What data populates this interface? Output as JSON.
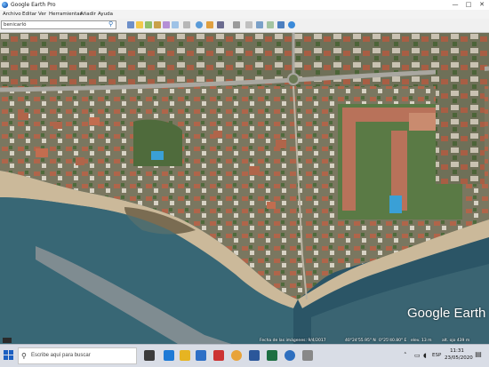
{
  "window": {
    "title": "Google Earth Pro",
    "minimize": "—",
    "maximize": "□",
    "close": "✕"
  },
  "menu": [
    "Archivo",
    "Editar",
    "Ver",
    "Herramientas",
    "Añadir",
    "Ayuda"
  ],
  "search": {
    "value": "benicarló"
  },
  "map": {
    "logo": "Google Earth",
    "status_date": "Fecha de las imágenes: 9/4/2017",
    "status_coords": "40°24'55.95\" N",
    "status_coords2": "0°25'40.80\" E",
    "status_elev": "elev. 13 m",
    "status_alt": "alt. ojo  439 m"
  },
  "taskbar": {
    "search_placeholder": "Escribe aquí para buscar",
    "clock_time": "11:31",
    "clock_date": "23/05/2020",
    "tray_language": "ESP"
  },
  "colors": {
    "sea_deep": "#2b5566",
    "sea_shallow": "#4a7b86",
    "beach": "#c9b89a",
    "land": "#7d7a62",
    "vegetation": "#4f6b3c",
    "roof_red": "#b0654a",
    "road": "#a9a7a0",
    "pool": "#3aa0d6"
  }
}
